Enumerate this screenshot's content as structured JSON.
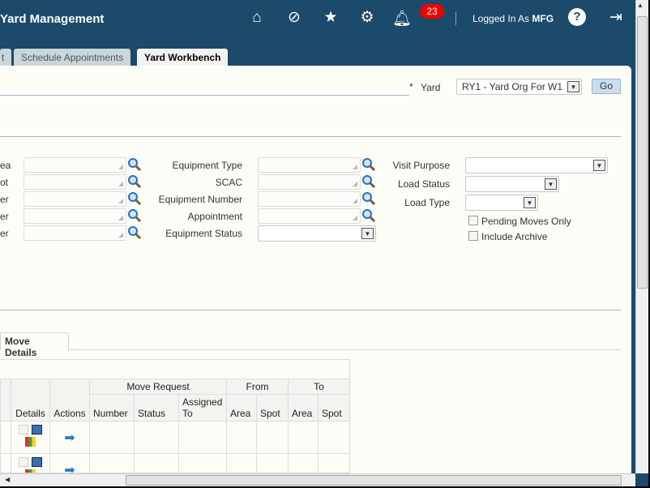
{
  "header": {
    "title": "Yard Management",
    "notification_count": "23",
    "login_prefix": "Logged In As",
    "user": "MFG",
    "icons": [
      "home-icon",
      "compass-icon",
      "star-icon",
      "gear-icon",
      "bell-icon",
      "help-icon",
      "logout-icon"
    ]
  },
  "tabs": [
    {
      "label": "t"
    },
    {
      "label": "Schedule Appointments"
    },
    {
      "label": "Yard Workbench",
      "active": true
    }
  ],
  "yard": {
    "required": "*",
    "label": "Yard",
    "value": "RY1 - Yard Org For W1",
    "go": "Go"
  },
  "search": {
    "left_labels": [
      "ea",
      "ot",
      "er",
      "er",
      "er"
    ],
    "middle": [
      {
        "label": "Equipment Type",
        "type": "lov"
      },
      {
        "label": "SCAC",
        "type": "lov"
      },
      {
        "label": "Equipment Number",
        "type": "lov"
      },
      {
        "label": "Appointment",
        "type": "lov"
      },
      {
        "label": "Equipment Status",
        "type": "select",
        "value": ""
      }
    ],
    "right": [
      {
        "label": "Visit Purpose",
        "value": ""
      },
      {
        "label": "Load Status",
        "value": ""
      },
      {
        "label": "Load Type",
        "value": ""
      }
    ],
    "checkboxes": [
      {
        "label": "Pending Moves Only",
        "checked": false
      },
      {
        "label": "Include Archive",
        "checked": false
      }
    ]
  },
  "results": {
    "tab": "Move Details",
    "groups": [
      "Move Request",
      "From",
      "To"
    ],
    "columns": [
      "Details",
      "Actions",
      "Number",
      "Status",
      "Assigned To",
      "Area",
      "Spot",
      "Area",
      "Spot"
    ]
  }
}
